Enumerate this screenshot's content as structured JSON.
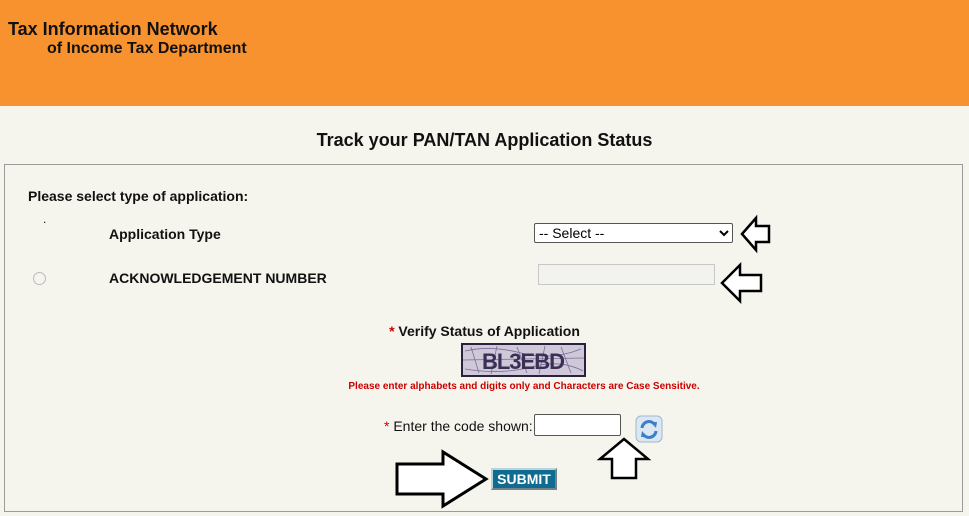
{
  "header": {
    "line1": "Tax Information Network",
    "line2": "of Income Tax Department",
    "bg_color": "#f7922e"
  },
  "page_title": "Track your PAN/TAN Application Status",
  "form": {
    "select_prompt": "Please select type of application:",
    "dot": ".",
    "application_type_label": "Application Type",
    "application_type_value": "-- Select --",
    "ack_label": "ACKNOWLEDGEMENT NUMBER",
    "ack_value": "",
    "verify_asterisk": "*",
    "verify_label": "Verify Status of Application",
    "captcha_text": "BL3EBD",
    "captcha_note": "Please enter alphabets and digits only and Characters are Case Sensitive.",
    "code_asterisk": "*",
    "code_label": "Enter the code shown:",
    "code_value": "",
    "submit_label": "SUBMIT",
    "submit_color": "#0f6b8f"
  },
  "icons": {
    "refresh": "refresh-icon",
    "arrow": "arrow-icon"
  }
}
